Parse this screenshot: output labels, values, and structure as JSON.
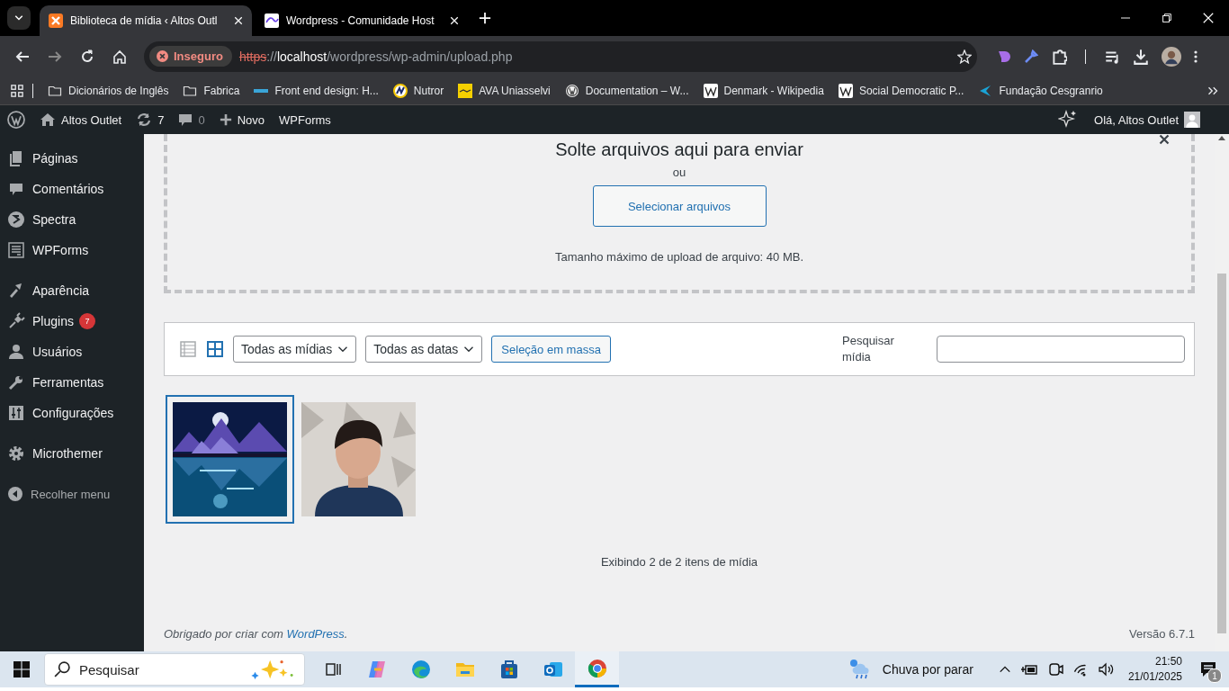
{
  "browser": {
    "tabs": [
      {
        "title": "Biblioteca de mídia ‹ Altos Outl",
        "kind": "xampp",
        "selected": true
      },
      {
        "title": "Wordpress - Comunidade Host",
        "kind": "hostinger",
        "selected": false
      }
    ],
    "security": "Inseguro",
    "url": {
      "scheme": "https",
      "sep": "://",
      "host": "localhost",
      "path": "/wordpress/wp-admin/upload.php"
    },
    "bookmarks": [
      {
        "label": "Dicionários de Inglês",
        "kind": "folder"
      },
      {
        "label": "Fabrica",
        "kind": "folder"
      },
      {
        "label": "Front end design: H...",
        "kind": "dpw"
      },
      {
        "label": "Nutror",
        "kind": "nutror"
      },
      {
        "label": "AVA Uniasselvi",
        "kind": "ava"
      },
      {
        "label": "Documentation – W...",
        "kind": "wordpress"
      },
      {
        "label": "Denmark - Wikipedia",
        "kind": "wikipedia"
      },
      {
        "label": "Social Democratic P...",
        "kind": "wikipedia"
      },
      {
        "label": "Fundação Cesgranrio",
        "kind": "cesgranrio"
      }
    ]
  },
  "admin_bar": {
    "site": "Altos Outlet",
    "updates": "7",
    "comments": "0",
    "new": "Novo",
    "wpforms": "WPForms",
    "greeting": "Olá, Altos Outlet"
  },
  "sidebar": {
    "groups": [
      {
        "items": [
          {
            "label": "Páginas",
            "kind": "pages"
          },
          {
            "label": "Comentários",
            "kind": "comments"
          },
          {
            "label": "Spectra",
            "kind": "spectra"
          },
          {
            "label": "WPForms",
            "kind": "forms"
          }
        ]
      },
      {
        "items": [
          {
            "label": "Aparência",
            "kind": "appearance"
          },
          {
            "label": "Plugins",
            "kind": "plugins",
            "badge": "7"
          },
          {
            "label": "Usuários",
            "kind": "users"
          },
          {
            "label": "Ferramentas",
            "kind": "tools"
          },
          {
            "label": "Configurações",
            "kind": "settings"
          }
        ]
      },
      {
        "items": [
          {
            "label": "Microthemer",
            "kind": "gear"
          }
        ]
      }
    ],
    "collapse": "Recolher menu"
  },
  "uploader": {
    "title": "Solte arquivos aqui para enviar",
    "or": "ou",
    "button": "Selecionar arquivos",
    "max_size": "Tamanho máximo de upload de arquivo: 40 MB."
  },
  "toolbar": {
    "views": [
      {
        "kind": "list",
        "selected": false
      },
      {
        "kind": "grid",
        "selected": true
      }
    ],
    "filters": [
      "Todas as mídias",
      "Todas as datas"
    ],
    "bulk": "Seleção em massa",
    "search_label": "Pesquisar mídia"
  },
  "media": [
    {
      "kind": "picture",
      "selected": true
    },
    {
      "kind": "picture",
      "selected": false
    }
  ],
  "count": "Exibindo 2 de 2 itens de mídia",
  "footer": {
    "thanks": "Obrigado por criar com ",
    "link": "WordPress",
    "end": ".",
    "version": "Versão 6.7.1"
  },
  "taskbar": {
    "search": "Pesquisar",
    "apps": [
      {
        "kind": "taskview",
        "selected": false
      },
      {
        "kind": "copilot",
        "selected": false
      },
      {
        "kind": "edge",
        "selected": false
      },
      {
        "kind": "explorer",
        "selected": false
      },
      {
        "kind": "store",
        "selected": false
      },
      {
        "kind": "outlook",
        "selected": false
      },
      {
        "kind": "chrome",
        "selected": true
      }
    ],
    "weather": "Chuva por parar",
    "time": "21:50",
    "date": "21/01/2025",
    "notifications": "1"
  }
}
